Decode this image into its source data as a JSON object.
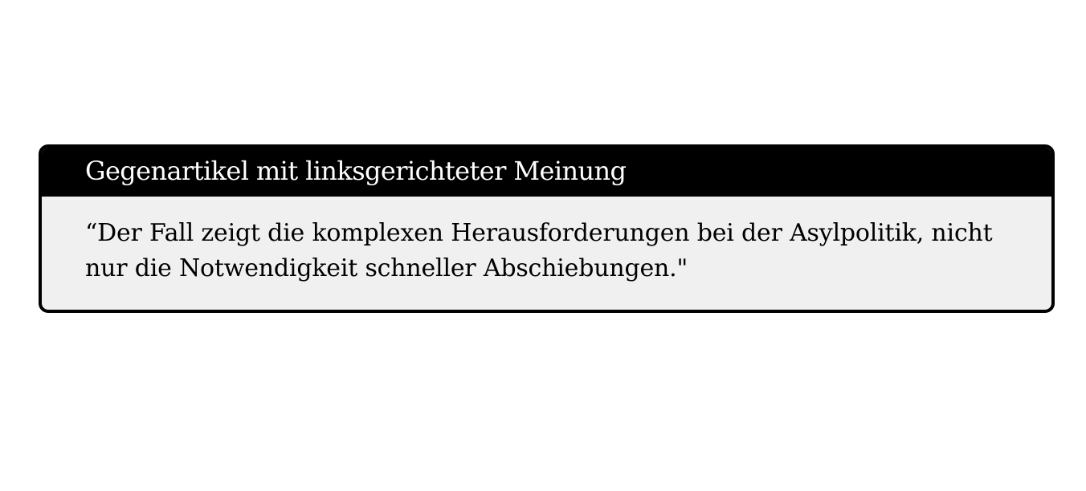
{
  "card": {
    "title": "Gegenartikel mit linksgerichteter Meinung",
    "quote": "“Der Fall zeigt die komplexen Herausforderungen bei der Asylpolitik, nicht nur die Notwendigkeit schneller Abschiebungen.\""
  },
  "colors": {
    "header_background": "#000000",
    "header_text": "#ffffff",
    "body_background": "#f0f0f0",
    "border": "#000000"
  }
}
